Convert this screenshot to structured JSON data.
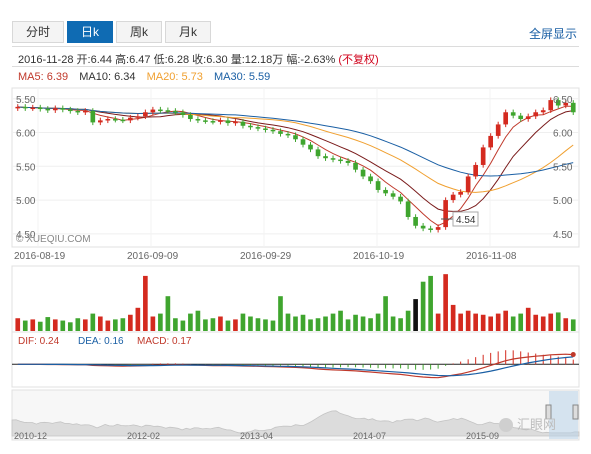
{
  "tabs": [
    {
      "label": "分时",
      "active": false
    },
    {
      "label": "日k",
      "active": true
    },
    {
      "label": "周k",
      "active": false
    },
    {
      "label": "月k",
      "active": false
    }
  ],
  "fullscreen_label": "全屏显示",
  "quote": {
    "date": "2016-11-28",
    "open_label": "开:",
    "open": "6.44",
    "high_label": "高:",
    "high": "6.47",
    "low_label": "低:",
    "low": "6.28",
    "close_label": "收:",
    "close": "6.30",
    "volume_label": "量:",
    "volume": "12.18万",
    "change_label": "幅:",
    "change": "-2.63%",
    "adjust": "(不复权)"
  },
  "ma": [
    {
      "label": "MA5",
      "value": "6.39",
      "color": "#c0392b"
    },
    {
      "label": "MA10",
      "value": "6.34",
      "color": "#333333"
    },
    {
      "label": "MA20",
      "value": "5.73",
      "color": "#f0a030"
    },
    {
      "label": "MA30",
      "value": "5.59",
      "color": "#1a5fa4"
    }
  ],
  "macd": {
    "dif_label": "DIF:",
    "dif": "0.24",
    "dea_label": "DEA:",
    "dea": "0.16",
    "macd_label": "MACD:",
    "macd": "0.17"
  },
  "watermark": "© XUEQIU.COM",
  "low_marker": "4.54",
  "logo_text": "汇眼网",
  "colors": {
    "up": "#d42a1f",
    "down": "#3fa52e",
    "ma5": "#c0392b",
    "ma10": "#7a1b1b",
    "ma20": "#f0a030",
    "ma30": "#1a5fa4"
  },
  "chart_data": {
    "type": "candlestick",
    "y_ticks_left": [
      "5.50",
      "6.00",
      "5.50",
      "5.00",
      "4.50"
    ],
    "y_ticks_right": [
      "6.50",
      "6.00",
      "5.50",
      "5.00",
      "4.50"
    ],
    "ylim": [
      4.35,
      6.6
    ],
    "x_ticks": [
      "2016-08-19",
      "2016-09-09",
      "2016-09-29",
      "2016-10-19",
      "2016-11-08"
    ],
    "closes": [
      6.38,
      6.36,
      6.37,
      6.35,
      6.33,
      6.36,
      6.34,
      6.32,
      6.3,
      6.32,
      6.15,
      6.18,
      6.2,
      6.19,
      6.18,
      6.22,
      6.24,
      6.3,
      6.34,
      6.33,
      6.32,
      6.3,
      6.26,
      6.2,
      6.18,
      6.17,
      6.16,
      6.18,
      6.14,
      6.16,
      6.1,
      6.08,
      6.06,
      6.04,
      6.02,
      5.98,
      5.96,
      5.9,
      5.82,
      5.75,
      5.65,
      5.62,
      5.6,
      5.58,
      5.55,
      5.45,
      5.35,
      5.28,
      5.15,
      5.1,
      5.05,
      4.98,
      4.75,
      4.62,
      4.58,
      4.56,
      4.6,
      5.0,
      5.08,
      5.12,
      5.35,
      5.52,
      5.78,
      5.95,
      6.12,
      6.3,
      6.25,
      6.2,
      6.24,
      6.3,
      6.33,
      6.48,
      6.4,
      6.44,
      6.3
    ],
    "volume_ratios": [
      0.22,
      0.18,
      0.2,
      0.16,
      0.24,
      0.2,
      0.18,
      0.15,
      0.22,
      0.2,
      0.3,
      0.25,
      0.18,
      0.2,
      0.22,
      0.28,
      0.4,
      0.95,
      0.25,
      0.3,
      0.6,
      0.22,
      0.18,
      0.3,
      0.35,
      0.2,
      0.22,
      0.25,
      0.18,
      0.2,
      0.3,
      0.25,
      0.22,
      0.2,
      0.18,
      0.6,
      0.3,
      0.25,
      0.28,
      0.2,
      0.22,
      0.25,
      0.3,
      0.35,
      0.2,
      0.28,
      0.25,
      0.22,
      0.3,
      0.6,
      0.25,
      0.22,
      0.35,
      0.55,
      0.85,
      0.95,
      0.3,
      0.98,
      0.45,
      0.3,
      0.35,
      0.3,
      0.28,
      0.25,
      0.3,
      0.35,
      0.25,
      0.3,
      0.4,
      0.28,
      0.25,
      0.3,
      0.32,
      0.22,
      0.2
    ],
    "macd_ylim": [
      -0.6,
      0.45
    ],
    "overview_x_ticks": [
      "2010-12",
      "2012-02",
      "2013-04",
      "2014-07",
      "2015-09"
    ]
  }
}
